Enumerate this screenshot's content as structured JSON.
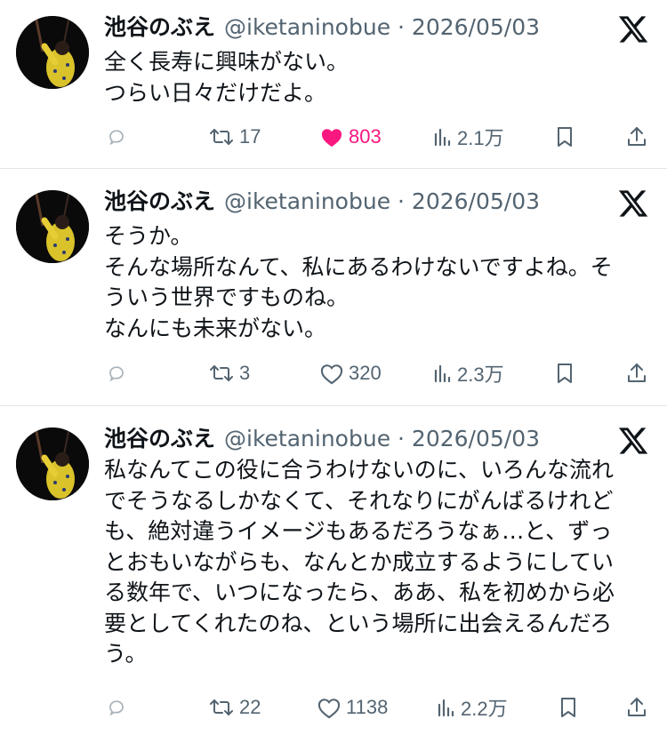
{
  "tweets": [
    {
      "name": "池谷のぶえ",
      "handle": "@iketaninobue",
      "sep": " · ",
      "date": "2026/05/03",
      "lines": [
        "全く長寿に興味がない。",
        "つらい日々だけだよ。"
      ],
      "retweets": "17",
      "likes": "803",
      "liked": true,
      "views": "2.1万"
    },
    {
      "name": "池谷のぶえ",
      "handle": "@iketaninobue",
      "sep": " · ",
      "date": "2026/05/03",
      "lines": [
        "そうか。",
        "そんな場所なんて、私にあるわけないですよね。そ",
        "ういう世界ですものね。",
        "なんにも未来がない。"
      ],
      "retweets": "3",
      "likes": "320",
      "liked": false,
      "views": "2.3万"
    },
    {
      "name": "池谷のぶえ",
      "handle": "@iketaninobue",
      "sep": " · ",
      "date": "2026/05/03",
      "lines": [
        "私なんてこの役に合うわけないのに、いろんな流れ",
        "でそうなるしかなくて、それなりにがんばるけれど",
        "も、絶対違うイメージもあるだろうなぁ…と、ずっ",
        "とおもいながらも、なんとか成立するようにしてい",
        "る数年で、いつになったら、ああ、私を初めから必",
        "要としてくれたのね、という場所に出会えるんだろ",
        "う。"
      ],
      "retweets": "22",
      "likes": "1138",
      "liked": false,
      "views": "2.2万"
    }
  ],
  "icons": {
    "reply": "reply-icon",
    "retweet": "retweet-icon",
    "like": "heart-icon",
    "views": "views-icon",
    "bookmark": "bookmark-icon",
    "share": "share-icon",
    "platform": "x-logo-icon"
  },
  "colors": {
    "text": "#0f1419",
    "secondary": "#536471",
    "like_active": "#f91880",
    "divider": "#e1e6ea"
  }
}
